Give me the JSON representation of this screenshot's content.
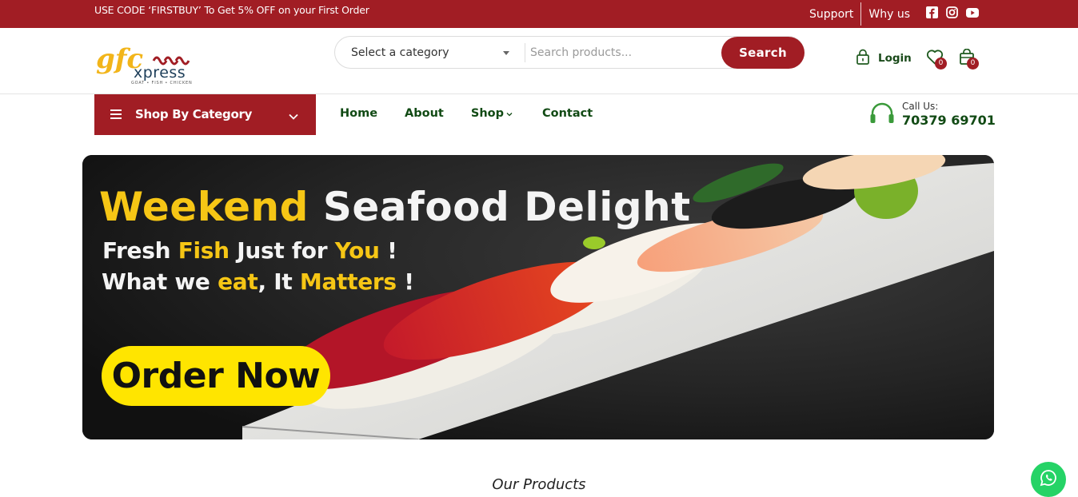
{
  "topbar": {
    "promo": "USE CODE ‘FIRSTBUY’ To Get 5% OFF on your First Order",
    "support": "Support",
    "why_us": "Why us",
    "social_icons": [
      "facebook-icon",
      "instagram-icon",
      "youtube-icon"
    ]
  },
  "header": {
    "logo": {
      "brand": "gfc xpress",
      "tagline": "GOAT • FISH • CHICKEN"
    },
    "search": {
      "category_placeholder": "Select a category",
      "input_placeholder": "Search products...",
      "button": "Search"
    },
    "login": "Login",
    "wishlist_count": "0",
    "cart_count": "0"
  },
  "nav": {
    "category_button": "Shop By Category",
    "links": {
      "home": "Home",
      "about": "About",
      "shop": "Shop",
      "contact": "Contact"
    },
    "call_label": "Call Us:",
    "phone": "70379 69701"
  },
  "hero": {
    "title_part1": "Weekend",
    "title_part2": "Seafood Delight",
    "line1": {
      "a": "Fresh ",
      "b": "Fish",
      "c": " Just for ",
      "d": "You",
      "e": " !"
    },
    "line2": {
      "a": "What we ",
      "b": "eat",
      "c": ", It ",
      "d": "Matters",
      "e": " !"
    },
    "cta": "Order Now"
  },
  "products_heading": "Our Products",
  "colors": {
    "brand_red": "#a11d24",
    "nav_green": "#114a14",
    "hero_yellow": "#f6c615",
    "cta_yellow": "#ffe500",
    "whatsapp_green": "#25d366"
  }
}
